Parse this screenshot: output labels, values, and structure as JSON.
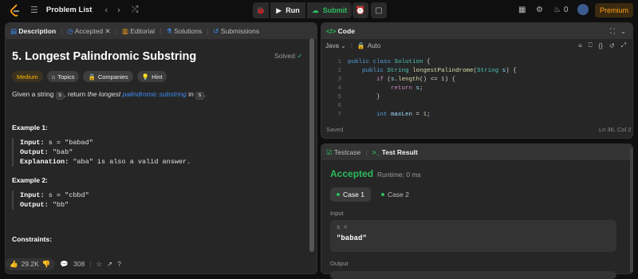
{
  "topbar": {
    "title": "Problem List",
    "run_label": "Run",
    "submit_label": "Submit",
    "streak": "0",
    "premium": "Premium"
  },
  "desc_tabs": {
    "description": "Description",
    "accepted": "Accepted",
    "editorial": "Editorial",
    "solutions": "Solutions",
    "submissions": "Submissions"
  },
  "problem": {
    "title": "5. Longest Palindromic Substring",
    "status": "Solved",
    "tags": {
      "difficulty": "Medium",
      "topics": "Topics",
      "companies": "Companies",
      "hint": "Hint"
    },
    "statement": {
      "p1": "Given a string ",
      "code1": "s",
      "p2": ", return ",
      "em": "the longest ",
      "link": "palindromic substring",
      "p3": " in ",
      "code2": "s",
      "p4": "."
    },
    "example1": {
      "heading": "Example 1:",
      "input_k": "Input:",
      "input_v": " s = \"babad\"",
      "output_k": "Output:",
      "output_v": " \"bab\"",
      "expl_k": "Explanation:",
      "expl_v": " \"aba\" is also a valid answer."
    },
    "example2": {
      "heading": "Example 2:",
      "input_k": "Input:",
      "input_v": " s = \"cbbd\"",
      "output_k": "Output:",
      "output_v": " \"bb\""
    },
    "constraints": "Constraints:"
  },
  "footer": {
    "likes": "29.2K",
    "comments": "308"
  },
  "code_panel": {
    "title": "Code",
    "language": "Java",
    "mode": "Auto",
    "saved": "Saved",
    "cursor": "Ln 36, Col 2",
    "lines": [
      {
        "n": "1",
        "t": "public class Solution {"
      },
      {
        "n": "2",
        "t": "    public String longestPalindrome(String s) {"
      },
      {
        "n": "3",
        "t": "        if (s.length() <= 1) {"
      },
      {
        "n": "4",
        "t": "            return s;"
      },
      {
        "n": "5",
        "t": "        }"
      },
      {
        "n": "6",
        "t": ""
      },
      {
        "n": "7",
        "t": "        int maxLen = 1;"
      }
    ]
  },
  "result_panel": {
    "tab1": "Testcase",
    "tab2": "Test Result",
    "verdict": "Accepted",
    "runtime": "Runtime: 0 ms",
    "case1": "Case 1",
    "case2": "Case 2",
    "input_label": "Input",
    "param": "s =",
    "value": "\"babad\"",
    "output_label": "Output"
  },
  "colors": {
    "accent": "#ffa116",
    "success": "#2cbb5d",
    "link": "#3c8bf4"
  }
}
